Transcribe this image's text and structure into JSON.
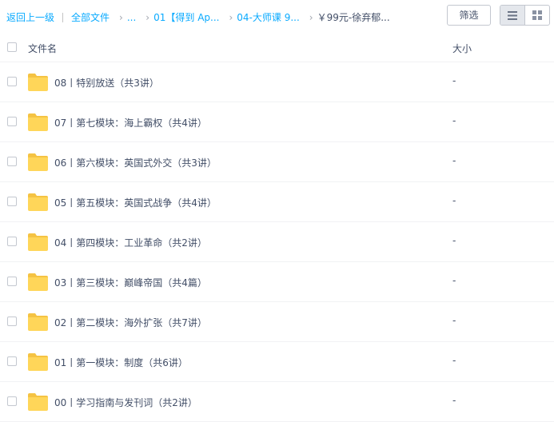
{
  "breadcrumb": {
    "back_label": "返回上一级",
    "root_label": "全部文件",
    "ellipsis": "...",
    "crumb_1": "01【得到 Ap...",
    "crumb_2": "04-大师课 9...",
    "current": "￥99元-徐弃郁..."
  },
  "toolbar": {
    "filter_label": "筛选",
    "view_list_icon": "list-view-icon",
    "view_grid_icon": "grid-view-icon",
    "active_view": "list"
  },
  "table": {
    "header_name": "文件名",
    "header_size": "大小",
    "rows": [
      {
        "name": "08丨特别放送（共3讲）",
        "size": "-"
      },
      {
        "name": "07丨第七模块：海上霸权（共4讲）",
        "size": "-"
      },
      {
        "name": "06丨第六模块：英国式外交（共3讲）",
        "size": "-"
      },
      {
        "name": "05丨第五模块：英国式战争（共4讲）",
        "size": "-"
      },
      {
        "name": "04丨第四模块：工业革命（共2讲）",
        "size": "-"
      },
      {
        "name": "03丨第三模块：巅峰帝国（共4篇）",
        "size": "-"
      },
      {
        "name": "02丨第二模块：海外扩张（共7讲）",
        "size": "-"
      },
      {
        "name": "01丨第一模块：制度（共6讲）",
        "size": "-"
      },
      {
        "name": "00丨学习指南与发刊词（共2讲）",
        "size": "-"
      }
    ]
  },
  "colors": {
    "link": "#09aaff",
    "text": "#424e67",
    "folder": "#ffd659",
    "folder_tab": "#f5c343"
  },
  "icons": {
    "row_icon": "folder-icon"
  }
}
